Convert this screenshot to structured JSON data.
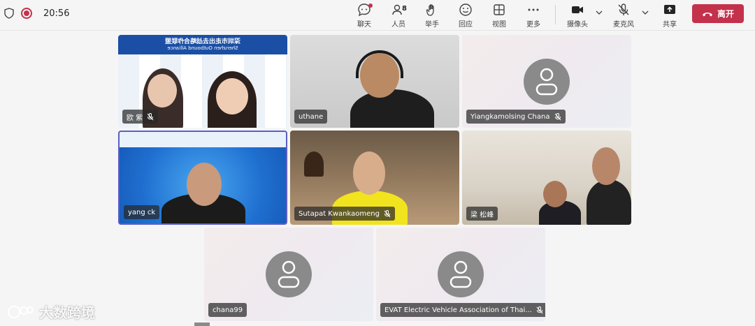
{
  "status": {
    "time": "20:56"
  },
  "toolbar": {
    "chat": "聊天",
    "people": "人员",
    "people_count": "8",
    "raise_hand": "举手",
    "react": "回应",
    "view": "视图",
    "more": "更多",
    "camera": "摄像头",
    "mic": "麦克风",
    "share": "共享",
    "leave": "离开"
  },
  "tiles": [
    {
      "name": "欧 紫",
      "muted": true,
      "banner_cn": "深圳市走出去战略合作联盟",
      "banner_en": "Shenzhen Outbound Alliance"
    },
    {
      "name": "uthane",
      "muted": false
    },
    {
      "name": "Yiangkamolsing Chana",
      "muted": true
    },
    {
      "name": "yang ck",
      "muted": false
    },
    {
      "name": "Sutapat Kwankaomeng",
      "muted": true
    },
    {
      "name": "梁 松峰",
      "muted": false
    },
    {
      "name": "chana99",
      "muted": false
    },
    {
      "name": "EVAT Electric Vehicle Association of Thai...",
      "muted": true
    }
  ],
  "watermark": {
    "text": "大数跨境"
  },
  "icons": {
    "chat": "chat-icon",
    "people": "people-icon",
    "raise_hand": "hand-icon",
    "react": "smile-icon",
    "view": "grid-icon",
    "more": "more-icon",
    "camera": "camera-icon",
    "mic": "mic-off-icon",
    "share": "share-icon",
    "leave": "phone-hangup-icon"
  },
  "colors": {
    "accent": "#5b5fc7",
    "leave": "#c4314b",
    "recording": "#c4314b"
  }
}
